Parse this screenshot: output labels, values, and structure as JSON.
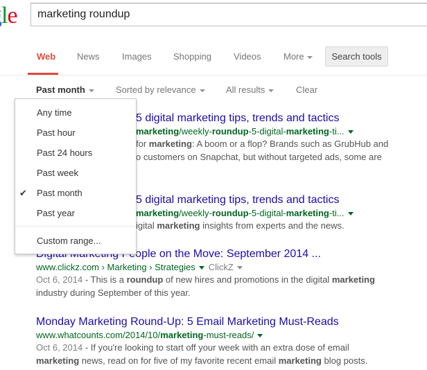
{
  "search": {
    "query": "marketing roundup"
  },
  "tabs": [
    "Web",
    "News",
    "Images",
    "Shopping",
    "Videos",
    "More"
  ],
  "search_tools": "Search tools",
  "filters": {
    "time": "Past month",
    "sort": "Sorted by relevance",
    "results": "All results",
    "clear": "Clear"
  },
  "dropdown": {
    "items": [
      "Any time",
      "Past hour",
      "Past 24 hours",
      "Past week",
      "Past month",
      "Past year"
    ],
    "checked": "Past month",
    "custom": "Custom range..."
  },
  "results": [
    {
      "title": "5 digital marketing tips, trends and tactics",
      "url_pre": "",
      "url_bold1": "marketing",
      "url_mid1": "/weekly-",
      "url_bold2": "roundup",
      "url_mid2": "-5-digital-",
      "url_bold3": "marketing",
      "url_post": "-ti...",
      "snip1_pre": " for ",
      "snip1_bold": "marketing",
      "snip1_post": ": A boom or a flop? Brands such as GrubHub and",
      "snip2": "o customers on Snapchat, but without targeted ads, some are"
    },
    {
      "title": "5 digital marketing tips, trends and tactics",
      "url_bold1": "marketing",
      "url_mid1": "/weekly-",
      "url_bold2": "roundup",
      "url_mid2": "-5-digital-",
      "url_bold3": "marketing",
      "url_post": "-ti...",
      "snip1_pre": "igital ",
      "snip1_bold": "marketing",
      "snip1_post": " insights from experts and the news."
    },
    {
      "title": "Digital Marketing People on the Move: September 2014 ...",
      "url": "www.clickz.com › Marketing › Strategies",
      "source": "ClickZ",
      "date": "Oct 6, 2014",
      "snip1_pre": " - This is a ",
      "snip1_bold1": "roundup",
      "snip1_mid": " of new hires and promotions in the digital ",
      "snip1_bold2": "marketing",
      "snip2": "industry during September of this year."
    },
    {
      "title": "Monday Marketing Round-Up: 5 Email Marketing Must-Reads",
      "url_pre": "www.whatcounts.com/2014/10/",
      "url_bold": "marketing",
      "url_post": "-must-reads/",
      "date": "Oct 6, 2014",
      "snip1_post": " - If you're looking to start off your week with an extra dose of email",
      "snip2_bold1": "marketing",
      "snip2_mid": " news, read on for five of my favorite recent email ",
      "snip2_bold2": "marketing",
      "snip2_post": " blog posts."
    }
  ]
}
